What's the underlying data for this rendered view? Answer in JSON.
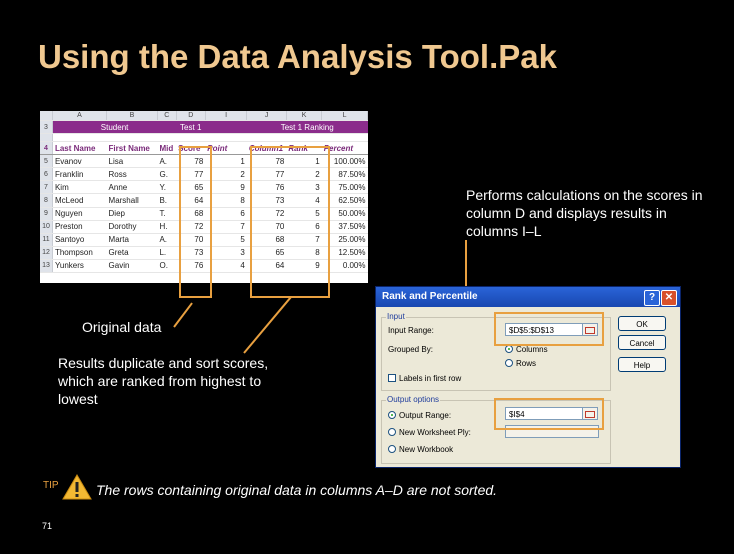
{
  "slide": {
    "title": "Using the Data Analysis Tool.Pak",
    "page_number": "71"
  },
  "spreadsheet": {
    "column_letters": [
      "",
      "A",
      "B",
      "C",
      "D",
      "I",
      "J",
      "K",
      "L"
    ],
    "band_row": {
      "row": "3",
      "student": "Student",
      "test1": "Test 1",
      "ranking": "Test 1 Ranking"
    },
    "header_row": {
      "row": "4",
      "cells": [
        "Last Name",
        "First Name",
        "Mid",
        "Score",
        "Point",
        "Column1",
        "Rank",
        "Percent"
      ]
    },
    "rows": [
      {
        "row": "5",
        "cells": [
          "Evanov",
          "Lisa",
          "A.",
          "78",
          "1",
          "78",
          "1",
          "100.00%"
        ]
      },
      {
        "row": "6",
        "cells": [
          "Franklin",
          "Ross",
          "G.",
          "77",
          "2",
          "77",
          "2",
          "87.50%"
        ]
      },
      {
        "row": "7",
        "cells": [
          "Kim",
          "Anne",
          "Y.",
          "65",
          "9",
          "76",
          "3",
          "75.00%"
        ]
      },
      {
        "row": "8",
        "cells": [
          "McLeod",
          "Marshall",
          "B.",
          "64",
          "8",
          "73",
          "4",
          "62.50%"
        ]
      },
      {
        "row": "9",
        "cells": [
          "Nguyen",
          "Diep",
          "T.",
          "68",
          "6",
          "72",
          "5",
          "50.00%"
        ]
      },
      {
        "row": "10",
        "cells": [
          "Preston",
          "Dorothy",
          "H.",
          "72",
          "7",
          "70",
          "6",
          "37.50%"
        ]
      },
      {
        "row": "11",
        "cells": [
          "Santoyo",
          "Marta",
          "A.",
          "70",
          "5",
          "68",
          "7",
          "25.00%"
        ]
      },
      {
        "row": "12",
        "cells": [
          "Thompson",
          "Greta",
          "L.",
          "73",
          "3",
          "65",
          "8",
          "12.50%"
        ]
      },
      {
        "row": "13",
        "cells": [
          "Yunkers",
          "Gavin",
          "O.",
          "76",
          "4",
          "64",
          "9",
          "0.00%"
        ]
      }
    ]
  },
  "callouts": {
    "performs": "Performs calculations on the scores in column D and displays results in columns I–L",
    "original": "Original data",
    "results": "Results duplicate and sort scores, which are ranked from highest to lowest"
  },
  "dialog": {
    "title": "Rank and Percentile",
    "help_glyph": "?",
    "close_glyph": "✕",
    "input_group": "Input",
    "input_range_label": "Input Range:",
    "input_range_value": "$D$5:$D$13",
    "grouped_by_label": "Grouped By:",
    "columns_option": "Columns",
    "rows_option": "Rows",
    "labels_checkbox": "Labels in first row",
    "output_group": "Output options",
    "output_range_label": "Output Range:",
    "output_range_value": "$I$4",
    "new_ply_label": "New Worksheet Ply:",
    "new_workbook_label": "New Workbook",
    "ok": "OK",
    "cancel": "Cancel",
    "help": "Help"
  },
  "tip": {
    "label": "TIP",
    "text": "The rows containing original data in columns A–D are not sorted."
  },
  "colors": {
    "accent": "#e8a040",
    "title": "#f0c890",
    "band": "#8b2c8b"
  }
}
